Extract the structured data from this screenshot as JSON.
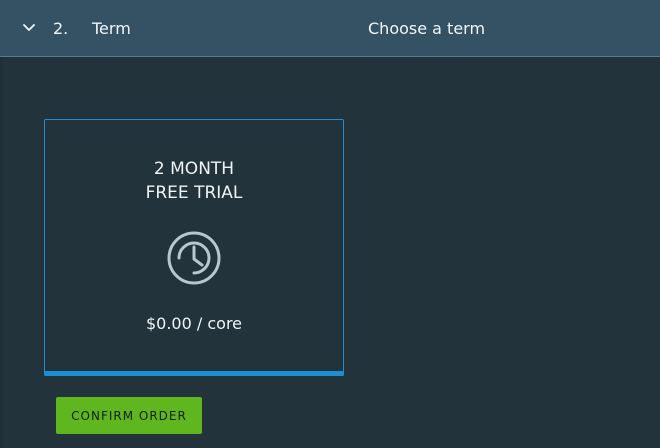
{
  "step": {
    "number": "2.",
    "title": "Term",
    "summary": "Choose a term",
    "chevron_icon": "chevron-down-icon"
  },
  "term_card": {
    "title_line1": "2 MONTH",
    "title_line2": "FREE TRIAL",
    "icon": "clock-icon",
    "price": "$0.00 / core",
    "selected": true
  },
  "actions": {
    "confirm_label": "CONFIRM ORDER"
  },
  "colors": {
    "header_bg": "#355264",
    "page_bg": "#22333b",
    "card_border": "#1f8fd0",
    "selected_bar": "#1a8fd6",
    "confirm_bg": "#5fb61f",
    "icon_stroke": "#b9c6cd"
  }
}
